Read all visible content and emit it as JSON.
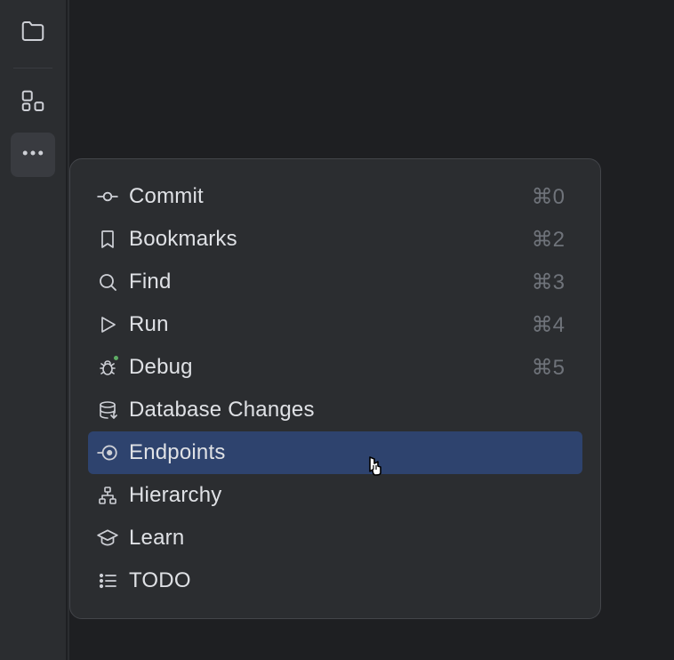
{
  "sidebar": {
    "items": [
      {
        "name": "project-files",
        "active": false
      },
      {
        "name": "structure",
        "active": false
      },
      {
        "name": "more",
        "active": true
      }
    ]
  },
  "menu": {
    "items": [
      {
        "label": "Commit",
        "shortcut": "⌘0",
        "icon": "commit-icon",
        "highlighted": false,
        "notification": false
      },
      {
        "label": "Bookmarks",
        "shortcut": "⌘2",
        "icon": "bookmark-icon",
        "highlighted": false,
        "notification": false
      },
      {
        "label": "Find",
        "shortcut": "⌘3",
        "icon": "search-icon",
        "highlighted": false,
        "notification": false
      },
      {
        "label": "Run",
        "shortcut": "⌘4",
        "icon": "play-icon",
        "highlighted": false,
        "notification": false
      },
      {
        "label": "Debug",
        "shortcut": "⌘5",
        "icon": "bug-icon",
        "highlighted": false,
        "notification": true
      },
      {
        "label": "Database Changes",
        "shortcut": "",
        "icon": "database-icon",
        "highlighted": false,
        "notification": false
      },
      {
        "label": "Endpoints",
        "shortcut": "",
        "icon": "endpoints-icon",
        "highlighted": true,
        "notification": false
      },
      {
        "label": "Hierarchy",
        "shortcut": "",
        "icon": "hierarchy-icon",
        "highlighted": false,
        "notification": false
      },
      {
        "label": "Learn",
        "shortcut": "",
        "icon": "learn-icon",
        "highlighted": false,
        "notification": false
      },
      {
        "label": "TODO",
        "shortcut": "",
        "icon": "todo-icon",
        "highlighted": false,
        "notification": false
      }
    ]
  }
}
